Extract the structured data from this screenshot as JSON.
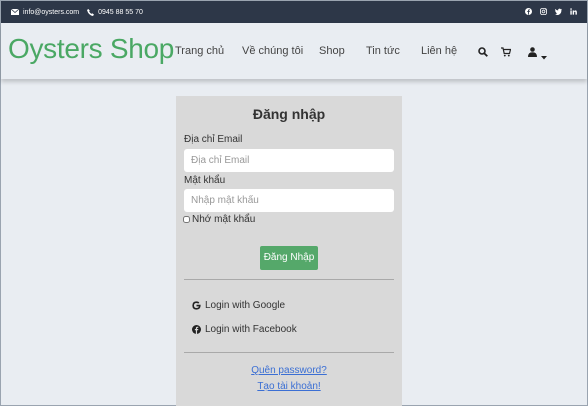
{
  "topbar": {
    "email": "info@oysters.com",
    "phone": "0945 88 55 70",
    "social": [
      "facebook-icon",
      "instagram-icon",
      "twitter-icon",
      "linkedin-icon"
    ]
  },
  "header": {
    "logo": "Oysters Shop",
    "nav": [
      "Trang chủ",
      "Về chúng tôi",
      "Shop",
      "Tin tức",
      "Liên hệ"
    ],
    "icons": [
      "search-icon",
      "cart-icon",
      "user-icon",
      "caret-down-icon"
    ]
  },
  "login": {
    "title": "Đăng nhập",
    "email_label": "Địa chỉ Email",
    "email_placeholder": "Địa chỉ Email",
    "password_label": "Mật khẩu",
    "password_placeholder": "Nhập mật khẩu",
    "remember_label": "Nhớ mật khẩu",
    "submit_label": "Đăng Nhập",
    "google_label": "Login with Google",
    "facebook_label": "Login with Facebook",
    "forgot_label": "Quên password?",
    "register_label": "Tạo tài khoản!"
  },
  "colors": {
    "brand": "#4aa864",
    "button": "#55a86a",
    "topbar": "#2d3748",
    "link": "#3b6fd4"
  }
}
